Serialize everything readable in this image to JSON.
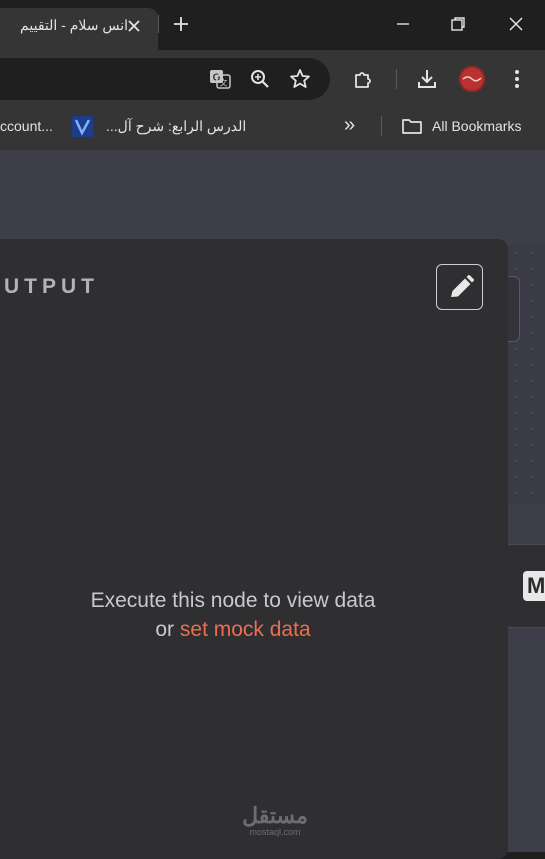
{
  "browser": {
    "tab": {
      "title": "انس سلام - التقييم"
    },
    "bookmarks": {
      "items": [
        {
          "label": "ccount..."
        },
        {
          "label": "الدرس الرابع: شرح آل..."
        }
      ],
      "overflow_label": "»",
      "all_bookmarks_label": "All Bookmarks"
    }
  },
  "panel": {
    "title": "UTPUT",
    "empty_message_line1": "Execute this node to view data",
    "empty_message_or": "or",
    "empty_message_link": "set mock data"
  },
  "side_node": {
    "label": "M"
  },
  "watermark": {
    "arabic": "مستقل",
    "latin": "mostaql.com"
  },
  "colors": {
    "accent_link": "#ec6d50",
    "panel_bg": "#2f2f31",
    "canvas_bg": "#3e3e4a",
    "chrome_bg": "#353535"
  }
}
